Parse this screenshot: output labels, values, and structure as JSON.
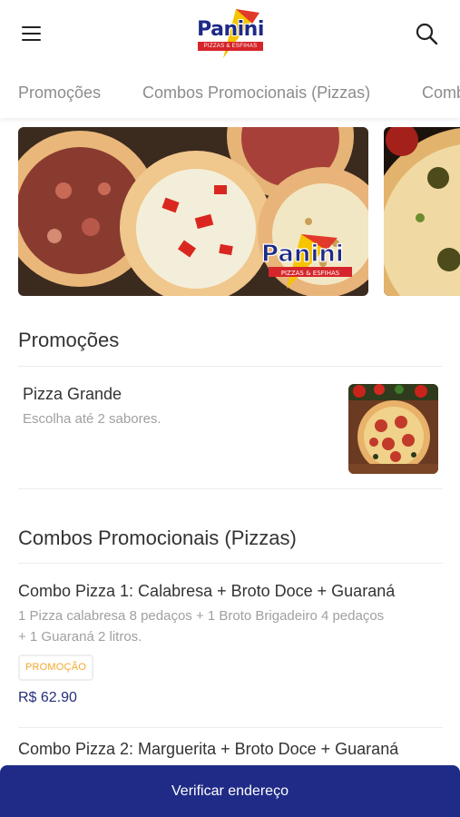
{
  "header": {
    "logo": {
      "name": "Panini",
      "tagline": "PIZZAS & ESFIHAS"
    },
    "icons": {
      "menu": "hamburger-menu-icon",
      "search": "search-icon"
    }
  },
  "tabs": [
    "Promoções",
    "Combos Promocionais (Pizzas)",
    "Combos"
  ],
  "banners": [
    {
      "brand": "Panini",
      "tagline": "PIZZAS & ESFIHAS"
    }
  ],
  "sections": [
    {
      "title": "Promoções",
      "items": [
        {
          "name": "Pizza Grande",
          "description": "Escolha até 2 sabores."
        }
      ]
    },
    {
      "title": "Combos Promocionais (Pizzas)",
      "items": [
        {
          "name": "Combo Pizza 1: Calabresa + Broto Doce + Guaraná",
          "description_line1": "1 Pizza calabresa 8 pedaços + 1 Broto Brigadeiro 4 pedaços",
          "description_line2": "+ 1 Guaraná 2 litros.",
          "badge": "PROMOÇÃO",
          "price": "R$ 62.90"
        },
        {
          "name": "Combo Pizza 2: Marguerita + Broto Doce + Guaraná"
        }
      ]
    }
  ],
  "bottom_button": "Verificar endereço",
  "colors": {
    "brand_blue": "#1f2b86",
    "badge_orange": "#f2a92d",
    "price_blue": "#24307b",
    "logo_red": "#d6252a"
  }
}
